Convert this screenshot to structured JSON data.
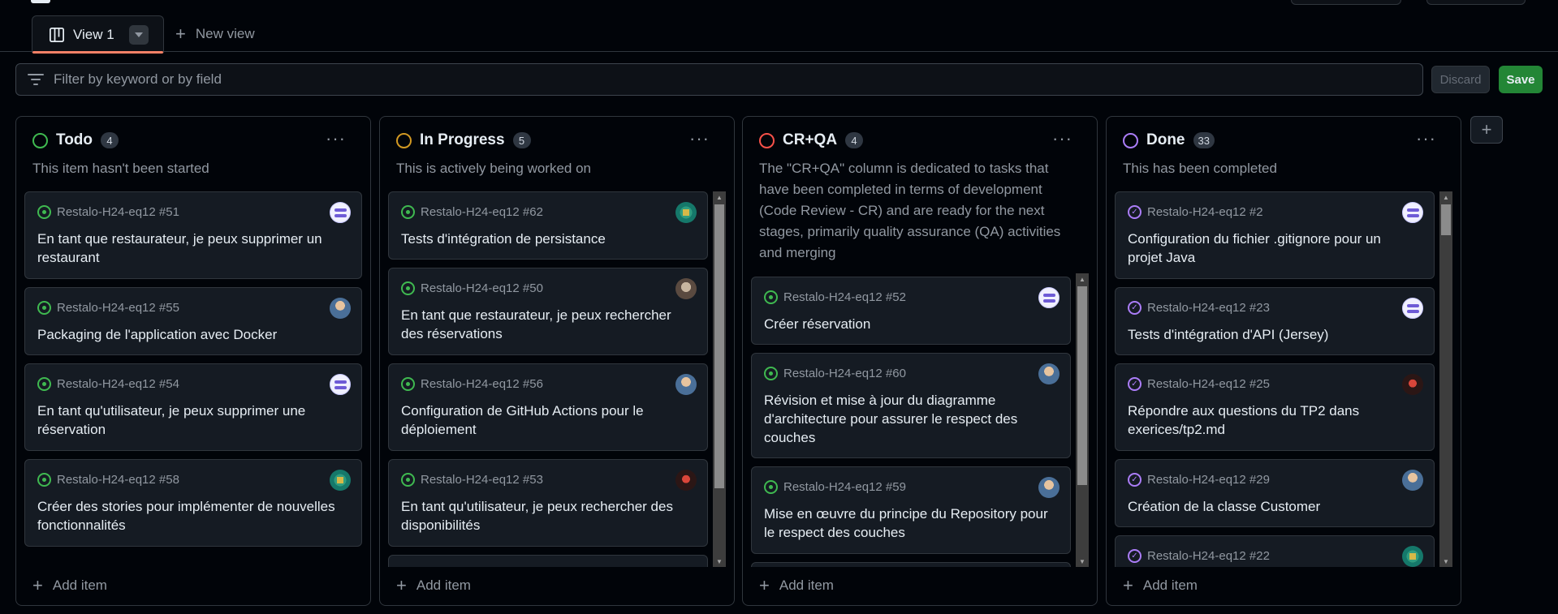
{
  "tabs": {
    "current": "View 1",
    "new_view": "New view"
  },
  "filter": {
    "placeholder": "Filter by keyword or by field"
  },
  "actions": {
    "discard": "Discard",
    "save": "Save"
  },
  "colors": {
    "todo": "#3fb950",
    "in_progress": "#d29922",
    "cr_qa": "#f85149",
    "done": "#ab7df8",
    "save_bg": "#238636"
  },
  "columns": [
    {
      "name": "Todo",
      "count": "4",
      "description": "This item hasn't been started",
      "add_item": "Add item",
      "cards": [
        {
          "ref": "Restalo-H24-eq12 #51",
          "title": "En tant que restaurateur, je peux supprimer un restaurant",
          "avatar": "avatar-a"
        },
        {
          "ref": "Restalo-H24-eq12 #55",
          "title": "Packaging de l'application avec Docker",
          "avatar": "avatar-b"
        },
        {
          "ref": "Restalo-H24-eq12 #54",
          "title": "En tant qu'utilisateur, je peux supprimer une réservation",
          "avatar": "avatar-a"
        },
        {
          "ref": "Restalo-H24-eq12 #58",
          "title": "Créer des stories pour implémenter de nouvelles fonctionnalités",
          "avatar": "avatar-c"
        }
      ]
    },
    {
      "name": "In Progress",
      "count": "5",
      "description": "This is actively being worked on",
      "add_item": "Add item",
      "cards": [
        {
          "ref": "Restalo-H24-eq12 #62",
          "title": "Tests d'intégration de persistance",
          "avatar": "avatar-c"
        },
        {
          "ref": "Restalo-H24-eq12 #50",
          "title": "En tant que restaurateur, je peux rechercher des réservations",
          "avatar": "avatar-e"
        },
        {
          "ref": "Restalo-H24-eq12 #56",
          "title": "Configuration de GitHub Actions pour le déploiement",
          "avatar": "avatar-b"
        },
        {
          "ref": "Restalo-H24-eq12 #53",
          "title": "En tant qu'utilisateur, je peux rechercher des disponibilités",
          "avatar": "avatar-d"
        }
      ]
    },
    {
      "name": "CR+QA",
      "count": "4",
      "description": "The \"CR+QA\" column is dedicated to tasks that have been completed in terms of development (Code Review - CR) and are ready for the next stages, primarily quality assurance (QA) activities and merging",
      "add_item": "Add item",
      "cards": [
        {
          "ref": "Restalo-H24-eq12 #52",
          "title": "Créer réservation",
          "avatar": "avatar-a"
        },
        {
          "ref": "Restalo-H24-eq12 #60",
          "title": "Révision et mise à jour du diagramme d'architecture pour assurer le respect des couches",
          "avatar": "avatar-b"
        },
        {
          "ref": "Restalo-H24-eq12 #59",
          "title": "Mise en œuvre du principe du Repository pour le respect des couches",
          "avatar": "avatar-b"
        }
      ]
    },
    {
      "name": "Done",
      "count": "33",
      "description": "This has been completed",
      "add_item": "Add item",
      "cards": [
        {
          "ref": "Restalo-H24-eq12 #2",
          "title": "Configuration du fichier .gitignore pour un projet Java",
          "avatar": "avatar-a"
        },
        {
          "ref": "Restalo-H24-eq12 #23",
          "title": "Tests d'intégration d'API (Jersey)",
          "avatar": "avatar-a"
        },
        {
          "ref": "Restalo-H24-eq12 #25",
          "title": "Répondre aux questions du TP2 dans exerices/tp2.md",
          "avatar": "avatar-d"
        },
        {
          "ref": "Restalo-H24-eq12 #29",
          "title": "Création de la classe Customer",
          "avatar": "avatar-b"
        },
        {
          "ref": "Restalo-H24-eq12 #22",
          "title": "",
          "avatar": "avatar-c"
        }
      ]
    }
  ]
}
